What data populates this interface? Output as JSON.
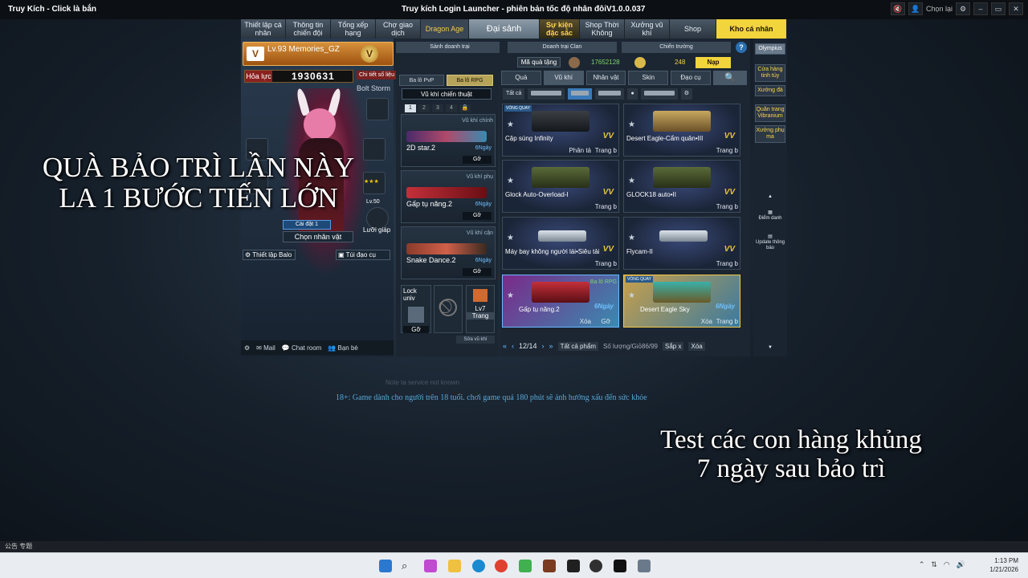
{
  "window": {
    "left_title": "Truy Kích - Click là bắn",
    "center_title": "Truy kích Login Launcher - phiên bản tốc độ nhân đôiV1.0.0.037",
    "chon_lai": "Chọn lại"
  },
  "topnav": [
    {
      "label": "Thiết lập cá nhân"
    },
    {
      "label": "Thông tin chiến đội"
    },
    {
      "label": "Tổng xếp hạng"
    },
    {
      "label": "Chợ giao dịch"
    },
    {
      "label": "Dragon Age"
    },
    {
      "label": "Đại sảnh"
    },
    {
      "label": "Sự kiện đặc sắc"
    },
    {
      "label": "Shop Thời Không"
    },
    {
      "label": "Xưởng vũ khí"
    },
    {
      "label": "Shop"
    },
    {
      "label": "Kho cá nhân"
    }
  ],
  "profile": {
    "name": "Lv.93 Memories_GZ",
    "vip": "V",
    "hoa_luc_label": "Hỏa lực",
    "hoa_luc_value": "1930631",
    "chi_tiet": "Chi tiết số liệu",
    "bolt_storm": "Bolt Storm",
    "cai_dat": "Cài đặt 1",
    "chon_nhan_vat": "Chọn nhân vật",
    "thiet_lap_balo": "Thiết lập Balo",
    "tui_dao_cu": "Túi đạo cụ",
    "luoi_giap": "Lưỡi giáp",
    "lv50": "Lv.50",
    "mail": "Mail",
    "chat_room": "Chat room",
    "ban_be": "Bạn bè"
  },
  "center": {
    "sanh_doanh_trai": "Sảnh doanh trại",
    "ba_lo_pvp": "Ba lô PvP",
    "ba_lo_rpg": "Ba lô RPG",
    "vu_khi_chien_thuat": "Vũ khí chiến thuật",
    "pages": [
      "1",
      "2",
      "3",
      "4"
    ],
    "slots": [
      {
        "type": "Vũ khí chính",
        "name": "2D star.2",
        "days": "6Ngày",
        "action": "Gỡ"
      },
      {
        "type": "Vũ khí phụ",
        "name": "Gấp tụ năng.2",
        "days": "6Ngày",
        "action": "Gỡ"
      },
      {
        "type": "Vũ khí cận",
        "name": "Snake Dance.2",
        "days": "6Ngày",
        "action": "Gỡ"
      }
    ],
    "lock_univ": "Lock univ",
    "go": "Gỡ",
    "lv7": "Lv7",
    "trang": "Trang",
    "sua_vu_khi": "Sửa vũ khí"
  },
  "shop": {
    "doanh_trai_clan": "Doanh trại Clan",
    "chien_truong": "Chiến trường",
    "help": "?",
    "ma_qua_tang": "Mã quà tặng",
    "balance1": "17652128",
    "balance2": "248",
    "nap": "Nạp",
    "filters": [
      "Quà",
      "Vũ khí",
      "Nhân vật",
      "Skin",
      "Đạo cụ"
    ],
    "search_icon": "search-icon",
    "tat_ca": "Tất cả",
    "cards": [
      {
        "name": "Cặp súng Infinity",
        "act1": "Phân tả",
        "act2": "Trang b",
        "vq": "VÒNG QUAY",
        "style": "dark"
      },
      {
        "name": "Desert Eagle-Cẩm quân•III",
        "act2": "Trang b",
        "style": "gold"
      },
      {
        "name": "Glock Auto-Overload-I",
        "act2": "Trang b",
        "style": "green"
      },
      {
        "name": "GLOCK18 auto•II",
        "act2": "Trang b",
        "style": "green"
      },
      {
        "name": "Máy bay không người lái•Siêu tải",
        "act2": "Trang b",
        "style": "drone"
      },
      {
        "name": "Flycam-II",
        "act2": "Trang b",
        "style": "drone"
      },
      {
        "name": "Gấp tụ năng.2",
        "act1": "Xóa",
        "act2": "Gỡ",
        "days": "6Ngày",
        "bl": "Ba lô RPG",
        "style": "red"
      },
      {
        "name": "Desert Eagle Sky",
        "act1": "Xóa",
        "act2": "Trang b",
        "vq": "VÒNG QUAY",
        "days": "6Ngày",
        "style": "teal"
      }
    ],
    "page": "12/14",
    "tat_ca_phu": "Tất cả phẩm",
    "so_luong": "Số lượng/Giỏ86/99",
    "sap_xep": "Sắp x",
    "xoa": "Xóa"
  },
  "rsidebar": {
    "olympius": "Olympius",
    "cua_hang": "Cửa hàng tinh túy",
    "xuong_da": "Xưởng đá",
    "quan_trang": "Quân trang Vibranium",
    "xuong_phu_ma": "Xưởng phụ ma",
    "diem_danh": "Điểm danh",
    "update": "Update thông báo"
  },
  "overlay": {
    "line1": "QUÀ BẢO TRÌ LẦN NÀY",
    "line2": "LA 1 BƯỚC TIẾN LỚN",
    "line3": "Test các con hàng khủng",
    "line4": "7 ngày sau bảo trì"
  },
  "notice": {
    "faint": "Note ta service not known",
    "age": "18+:   Game dành cho người trên 18 tuổi. chơi game quá 180 phút sẽ ảnh hưởng xấu đến sức khỏe"
  },
  "tray": {
    "label": "公告  专题"
  },
  "clock": {
    "time": "1:13 PM",
    "date": "1/21/2026"
  }
}
